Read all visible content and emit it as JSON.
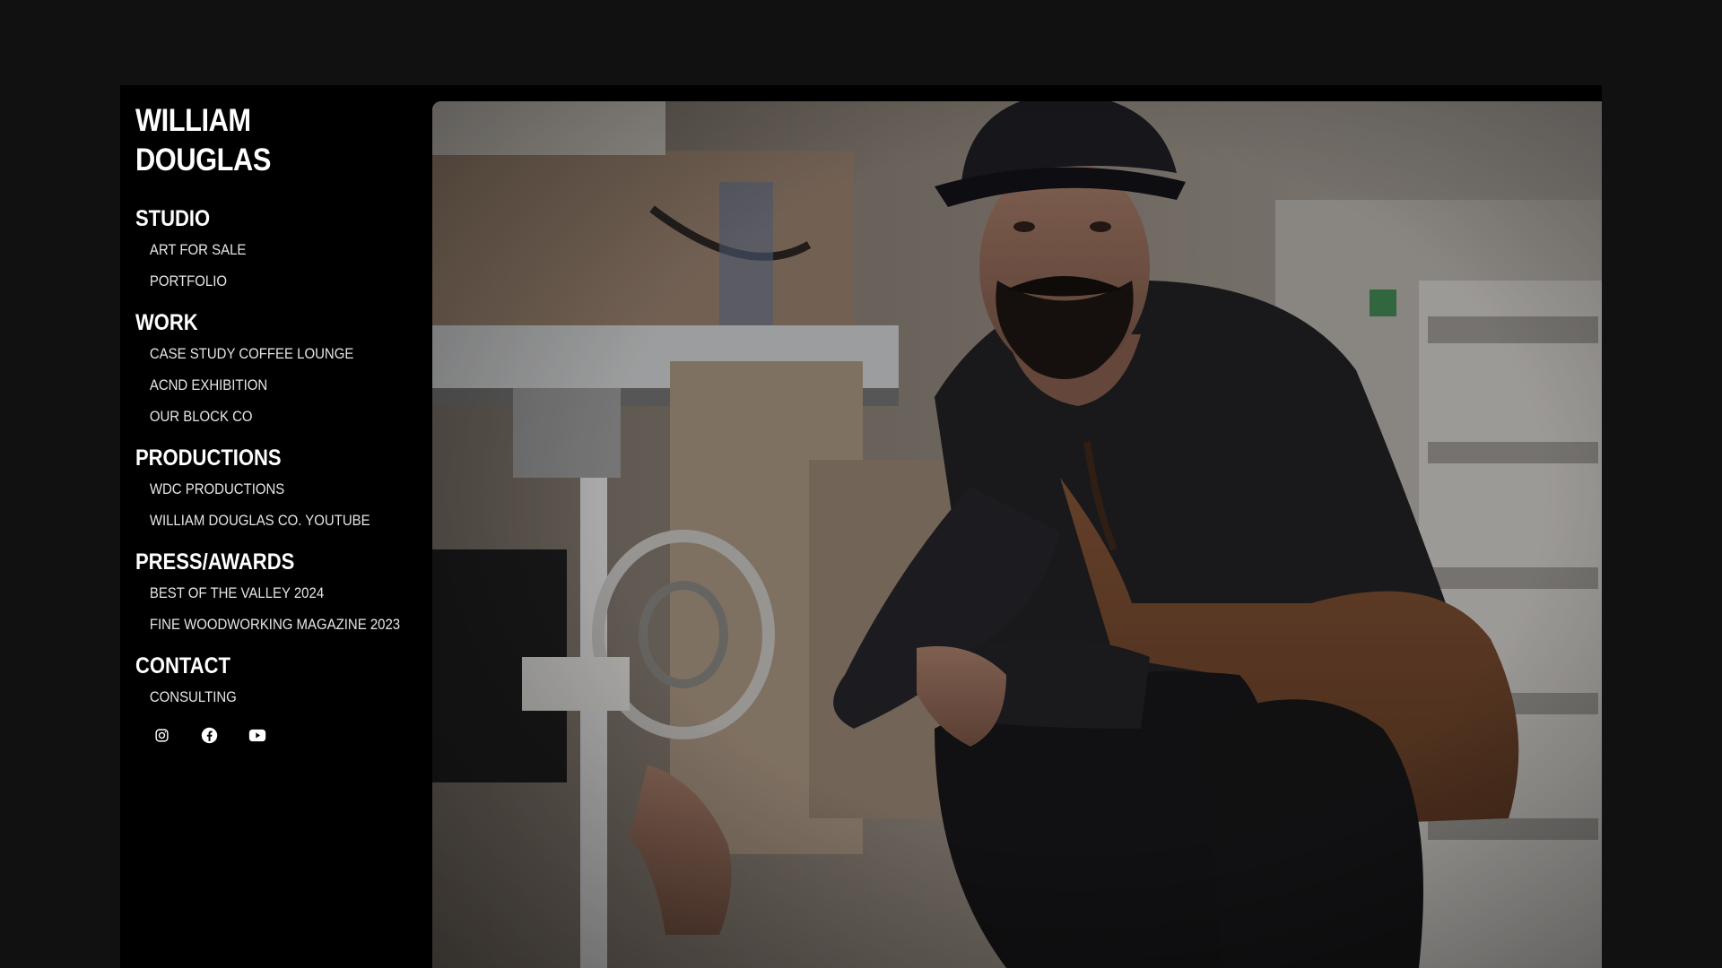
{
  "site": {
    "title_line1": "WILLIAM",
    "title_line2": "DOUGLAS"
  },
  "nav": [
    {
      "heading": "STUDIO",
      "items": [
        "ART FOR SALE",
        "PORTFOLIO"
      ]
    },
    {
      "heading": "WORK",
      "items": [
        "CASE STUDY COFFEE LOUNGE",
        "ACND EXHIBITION",
        "OUR BLOCK CO"
      ]
    },
    {
      "heading": "PRODUCTIONS",
      "items": [
        "WDC PRODUCTIONS",
        "WILLIAM DOUGLAS CO. YOUTUBE"
      ]
    },
    {
      "heading": "PRESS/AWARDS",
      "items": [
        "BEST OF THE VALLEY 2024",
        "FINE WOODWORKING MAGAZINE 2023"
      ]
    },
    {
      "heading": "CONTACT",
      "items": [
        "CONSULTING"
      ]
    }
  ],
  "social": [
    "instagram-icon",
    "facebook-icon",
    "youtube-icon"
  ],
  "colors": {
    "page_bg": "#111112",
    "frame_bg": "#000000",
    "text": "#ffffff"
  }
}
